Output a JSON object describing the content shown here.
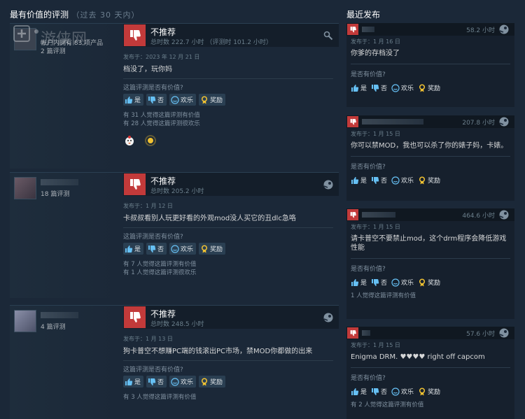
{
  "left": {
    "heading": "最有价值的评测",
    "heading_suffix": " （过去 30 天内）",
    "reviews": [
      {
        "author_meta1": "帐户内拥有 83 项产品",
        "author_meta2": "2 篇评测",
        "verdict": "不推荐",
        "hours": "总时数 222.7 小时 （评测时 101.2 小时）",
        "posted": "发布于：2023 年 12 月 21 日",
        "text": "档没了，玩你妈",
        "helpful_q": "这篇评测是否有价值?",
        "buttons": [
          "是",
          "否",
          "欢乐",
          "奖励"
        ],
        "count1": "有 31 人觉得这篇评测有价值",
        "count2": "有 28 人觉得这篇评测很欢乐",
        "award_icons": [
          "duck-award-icon",
          "sparkle-award-icon"
        ]
      },
      {
        "author_meta1": "18 篇评测",
        "verdict": "不推荐",
        "hours": "总时数 205.2 小时",
        "posted": "发布于：1 月 12 日",
        "text": "卡叔叔看别人玩更好看的外观mod没人买它的丑dlc急咯",
        "helpful_q": "这篇评测是否有价值?",
        "buttons": [
          "是",
          "否",
          "欢乐",
          "奖励"
        ],
        "count1": "有 7 人觉得这篇评测有价值",
        "count2": "有 1 人觉得这篇评测很欢乐"
      },
      {
        "author_meta1": "4 篇评测",
        "verdict": "不推荐",
        "hours": "总时数 248.5 小时",
        "posted": "发布于：1 月 13 日",
        "text": "狗卡普空不想赚PC端的钱滚出PC市场，禁MOD你都做的出来",
        "helpful_q": "这篇评测是否有价值?",
        "buttons": [
          "是",
          "否",
          "欢乐",
          "奖励"
        ],
        "count1": "有 3 人觉得这篇评测有价值"
      }
    ]
  },
  "right": {
    "heading": "最近发布",
    "reviews": [
      {
        "hours": "58.2 小时",
        "posted": "发布于：1 月 16 日",
        "text": "你爹的存档没了",
        "helpful_q": "是否有价值?",
        "buttons": [
          "是",
          "否",
          "欢乐",
          "奖励"
        ]
      },
      {
        "hours": "207.8 小时",
        "posted": "发布于：1 月 15 日",
        "text": "你可以禁MOD，我也可以杀了你的婊子妈，卡婊。",
        "helpful_q": "是否有价值?",
        "buttons": [
          "是",
          "否",
          "欢乐",
          "奖励"
        ]
      },
      {
        "hours": "464.6 小时",
        "posted": "发布于：1 月 15 日",
        "text": "请卡普空不要禁止mod，这个drm程序会降低游戏性能",
        "helpful_q": "是否有价值?",
        "buttons": [
          "是",
          "否",
          "欢乐",
          "奖励"
        ],
        "count1": "1 人觉得这篇评测有价值"
      },
      {
        "hours": "57.6 小时",
        "posted": "发布于：1 月 15 日",
        "text": "Enigma DRM. ♥♥♥♥ right off capcom",
        "helpful_q": "是否有价值?",
        "buttons": [
          "是",
          "否",
          "欢乐",
          "奖励"
        ],
        "count1": "有 2 人觉得这篇评测有价值"
      }
    ]
  },
  "colors": {
    "background": "#1b2838",
    "thumb_down": "#c23a3a",
    "button": "#2a3f52",
    "award": "#f1c232"
  },
  "watermark": "游侠网"
}
